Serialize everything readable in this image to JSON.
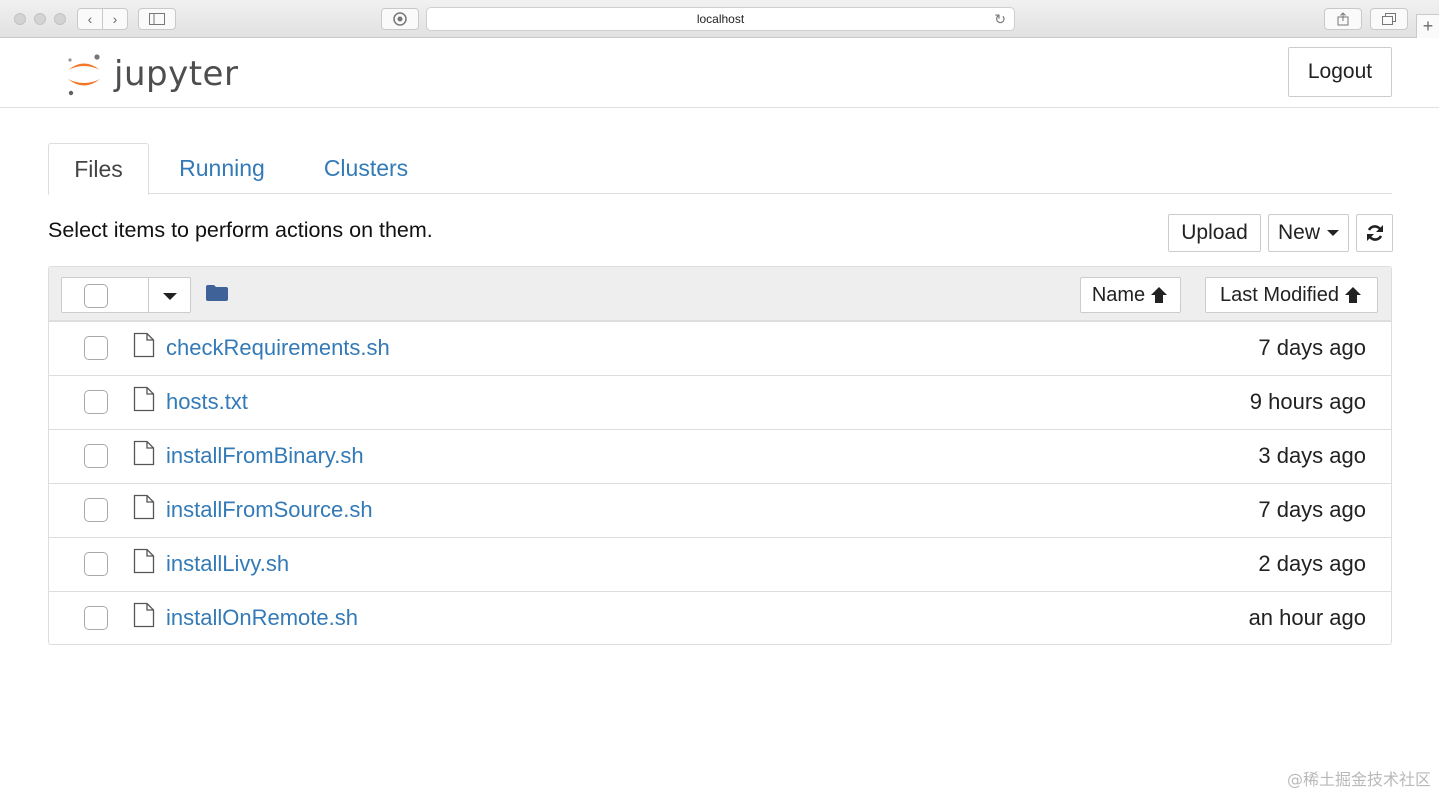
{
  "browser": {
    "url": "localhost"
  },
  "header": {
    "logo_text": "jupyter",
    "logout_label": "Logout"
  },
  "tabs": [
    {
      "label": "Files",
      "active": true
    },
    {
      "label": "Running",
      "active": false
    },
    {
      "label": "Clusters",
      "active": false
    }
  ],
  "toolbar": {
    "info_text": "Select items to perform actions on them.",
    "upload_label": "Upload",
    "new_label": "New"
  },
  "list_header": {
    "name_label": "Name",
    "modified_label": "Last Modified"
  },
  "files": [
    {
      "name": "checkRequirements.sh",
      "modified": "7 days ago"
    },
    {
      "name": "hosts.txt",
      "modified": "9 hours ago"
    },
    {
      "name": "installFromBinary.sh",
      "modified": "3 days ago"
    },
    {
      "name": "installFromSource.sh",
      "modified": "7 days ago"
    },
    {
      "name": "installLivy.sh",
      "modified": "2 days ago"
    },
    {
      "name": "installOnRemote.sh",
      "modified": "an hour ago"
    }
  ],
  "watermark": "@稀土掘金技术社区",
  "colors": {
    "link": "#337ab7",
    "logo_orange": "#f37726",
    "folder": "#3f6398"
  }
}
